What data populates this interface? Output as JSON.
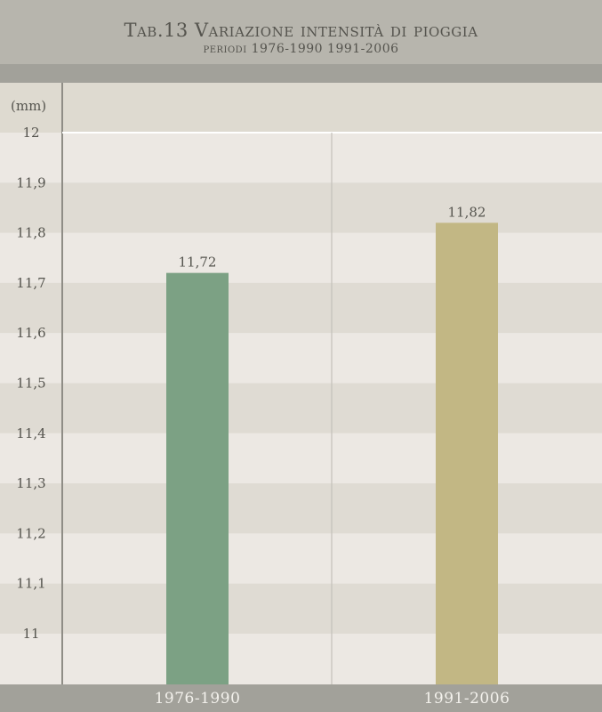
{
  "chart_data": {
    "type": "bar",
    "title": "Tab.13  Variazione intensità di pioggia",
    "subtitle": "periodi 1976-1990  1991-2006",
    "ylabel": "(mm)",
    "categories": [
      "1976-1990",
      "1991-2006"
    ],
    "values": [
      11.72,
      11.82
    ],
    "data_labels": [
      "11,72",
      "11,82"
    ],
    "ylim": [
      11,
      12
    ],
    "yticks": [
      12,
      11.9,
      11.8,
      11.7,
      11.6,
      11.5,
      11.4,
      11.3,
      11.2,
      11.1,
      11
    ],
    "ytick_labels": [
      "12",
      "11,9",
      "11,8",
      "11,7",
      "11,6",
      "11,5",
      "11,4",
      "11,3",
      "11,2",
      "11,1",
      "11"
    ],
    "colors": [
      "#7ca184",
      "#c2b784"
    ],
    "grid": "alternating horizontal bands"
  }
}
